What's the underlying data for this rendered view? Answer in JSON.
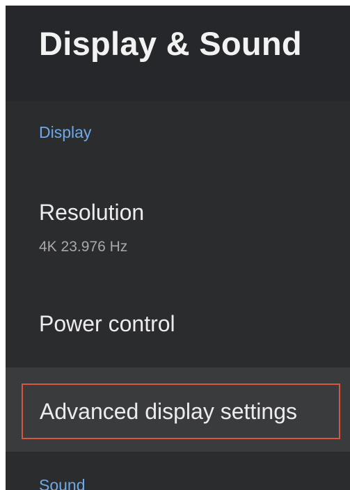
{
  "header": {
    "title": "Display & Sound"
  },
  "sections": {
    "display": {
      "label": "Display",
      "items": [
        {
          "title": "Resolution",
          "subtitle": "4K 23.976 Hz"
        },
        {
          "title": "Power control"
        },
        {
          "title": "Advanced display settings",
          "selected": true
        }
      ]
    },
    "sound": {
      "label": "Sound"
    }
  },
  "colors": {
    "background": "#2b2c2e",
    "header_background": "#26272a",
    "section_label": "#6fa8e8",
    "selected_row": "#3a3b3d",
    "highlight_border": "#d9553e"
  }
}
